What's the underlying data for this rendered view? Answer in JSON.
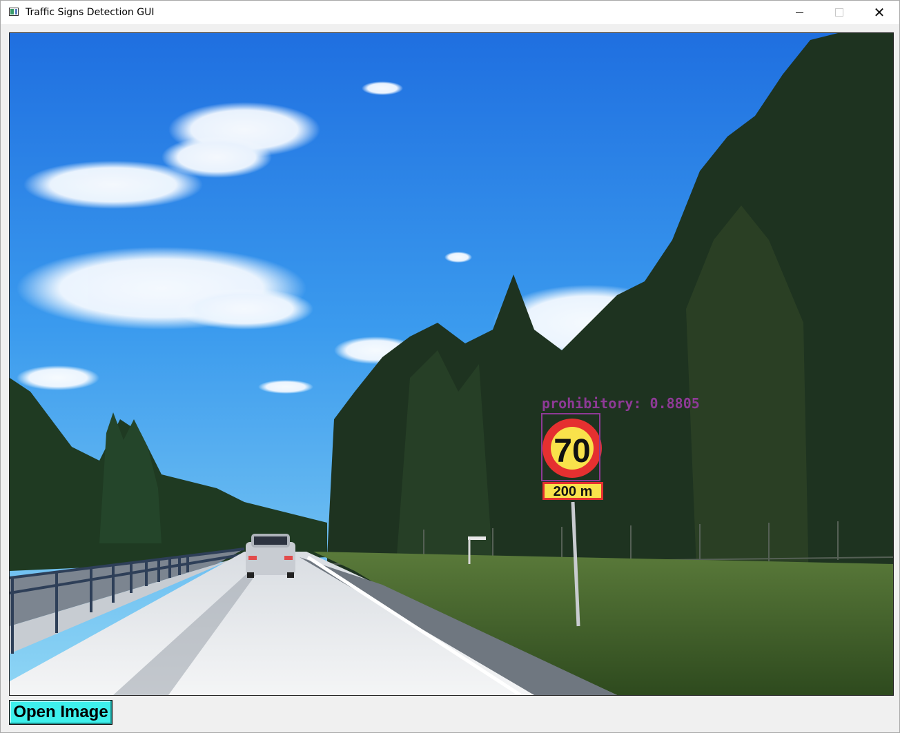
{
  "window": {
    "title": "Traffic Signs Detection GUI",
    "icon": "app-window-icon",
    "controls": {
      "minimize_icon": "minimize-icon",
      "maximize_icon": "maximize-icon",
      "close_icon": "close-icon",
      "close_glyph": "✕"
    }
  },
  "detection": {
    "label": "prohibitory: 0.8805",
    "color": "#8e3a96"
  },
  "scene": {
    "sign_number": "70",
    "sign_plate": "200 m"
  },
  "toolbar": {
    "open_label": "Open Image",
    "open_color": "#3ef0ec"
  }
}
